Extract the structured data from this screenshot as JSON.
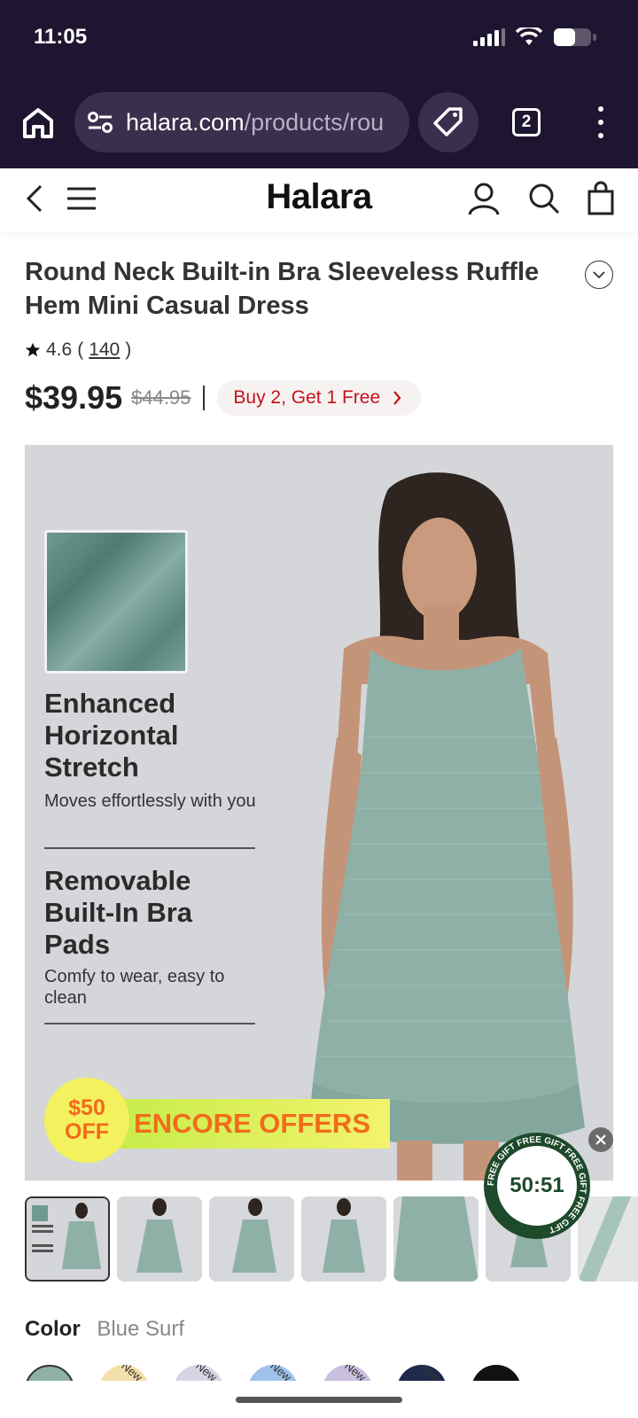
{
  "status": {
    "time": "11:05"
  },
  "browser": {
    "url_domain": "halara.com",
    "url_path": "/products/rou",
    "tab_count": "2"
  },
  "site": {
    "logo": "Halara"
  },
  "product": {
    "title": "Round Neck Built-in Bra Sleeveless Ruffle Hem Mini Casual Dress",
    "rating": "4.6",
    "rating_open": "(",
    "review_count": "140",
    "rating_close": ")",
    "price": "$39.95",
    "old_price": "$44.95",
    "promo": "Buy 2, Get 1 Free"
  },
  "hero": {
    "feature1_title": "Enhanced Horizontal Stretch",
    "feature1_sub": "Moves effortlessly with you",
    "feature2_title": "Removable Built-In Bra Pads",
    "feature2_sub": "Comfy to wear, easy to clean",
    "badge_amount": "$50",
    "badge_off": "OFF",
    "encore": "ENCORE OFFERS"
  },
  "timer": {
    "value": "50:51",
    "ring_text": "FREE GIFT FREE GIFT FREE GIFT FREE GIFT"
  },
  "color": {
    "label": "Color",
    "value": "Blue Surf"
  },
  "colors": {
    "accent_red": "#c4121a",
    "chrome_bg": "#1e1630",
    "dress_green": "#8fb0a7",
    "encore_orange": "#f36a1b"
  },
  "swatch_tag": "New"
}
